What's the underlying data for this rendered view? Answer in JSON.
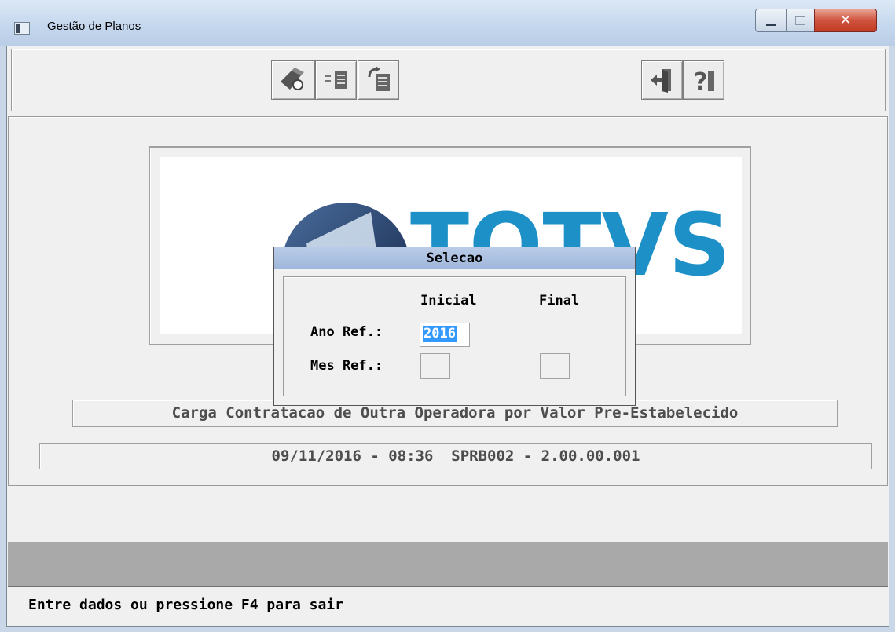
{
  "window": {
    "title": "Gestão de Planos"
  },
  "toolbar": {
    "icons": [
      "execute-icon",
      "list-icon",
      "history-icon",
      "exit-icon",
      "help-icon"
    ]
  },
  "logo": {
    "text": "TOTVS",
    "color": "#1e90c8"
  },
  "program": {
    "description": "Carga Contratacao de Outra Operadora por Valor Pre-Estabelecido",
    "version_line": "09/11/2016 - 08:36  SPRB002 - 2.00.00.001"
  },
  "dialog": {
    "title": "Selecao",
    "header_inicial": "Inicial",
    "header_final": "Final",
    "ano_label": "Ano Ref.:",
    "mes_label": "Mes Ref.:",
    "ano_inicial_value": "2016",
    "ano_final_value": "",
    "mes_inicial_value": "",
    "mes_final_value": ""
  },
  "status": {
    "message": "Entre dados ou pressione F4 para sair"
  },
  "colors": {
    "titlebar": "#c6d8ee",
    "dialog_title": "#a0b7dc",
    "selection": "#3399ff",
    "gray_band": "#a9a9a9"
  }
}
